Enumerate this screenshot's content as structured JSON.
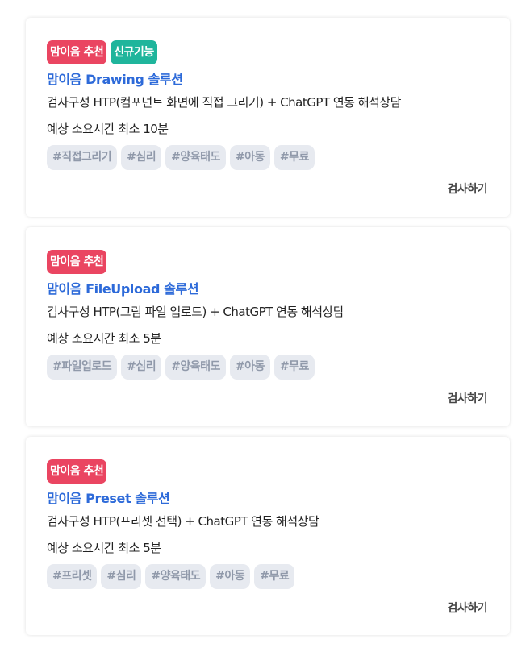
{
  "cards": [
    {
      "badges": [
        "맘이음 추천",
        "신규기능"
      ],
      "title": "맘이음 Drawing 솔루션",
      "description": "검사구성 HTP(컴포넌트 화면에 직접 그리기) + ChatGPT 연동 해석상담",
      "time": "예상 소요시간 최소 10분",
      "tags": [
        "#직접그리기",
        "#심리",
        "#양육태도",
        "#아동",
        "#무료"
      ],
      "action": "검사하기"
    },
    {
      "badges": [
        "맘이음 추천"
      ],
      "title": "맘이음 FileUpload 솔루션",
      "description": "검사구성 HTP(그림 파일 업로드) + ChatGPT 연동 해석상담",
      "time": "예상 소요시간 최소 5분",
      "tags": [
        "#파일업로드",
        "#심리",
        "#양육태도",
        "#아동",
        "#무료"
      ],
      "action": "검사하기"
    },
    {
      "badges": [
        "맘이음 추천"
      ],
      "title": "맘이음 Preset 솔루션",
      "description": "검사구성 HTP(프리셋 선택) + ChatGPT 연동 해석상담",
      "time": "예상 소요시간 최소 5분",
      "tags": [
        "#프리셋",
        "#심리",
        "#양육태도",
        "#아동",
        "#무료"
      ],
      "action": "검사하기"
    }
  ],
  "colors": {
    "recommend_badge": "#ea4561",
    "new_badge": "#1fb59c",
    "title": "#2d6ad9",
    "tag_bg": "#e7eaf0",
    "tag_text": "#9099aa"
  }
}
